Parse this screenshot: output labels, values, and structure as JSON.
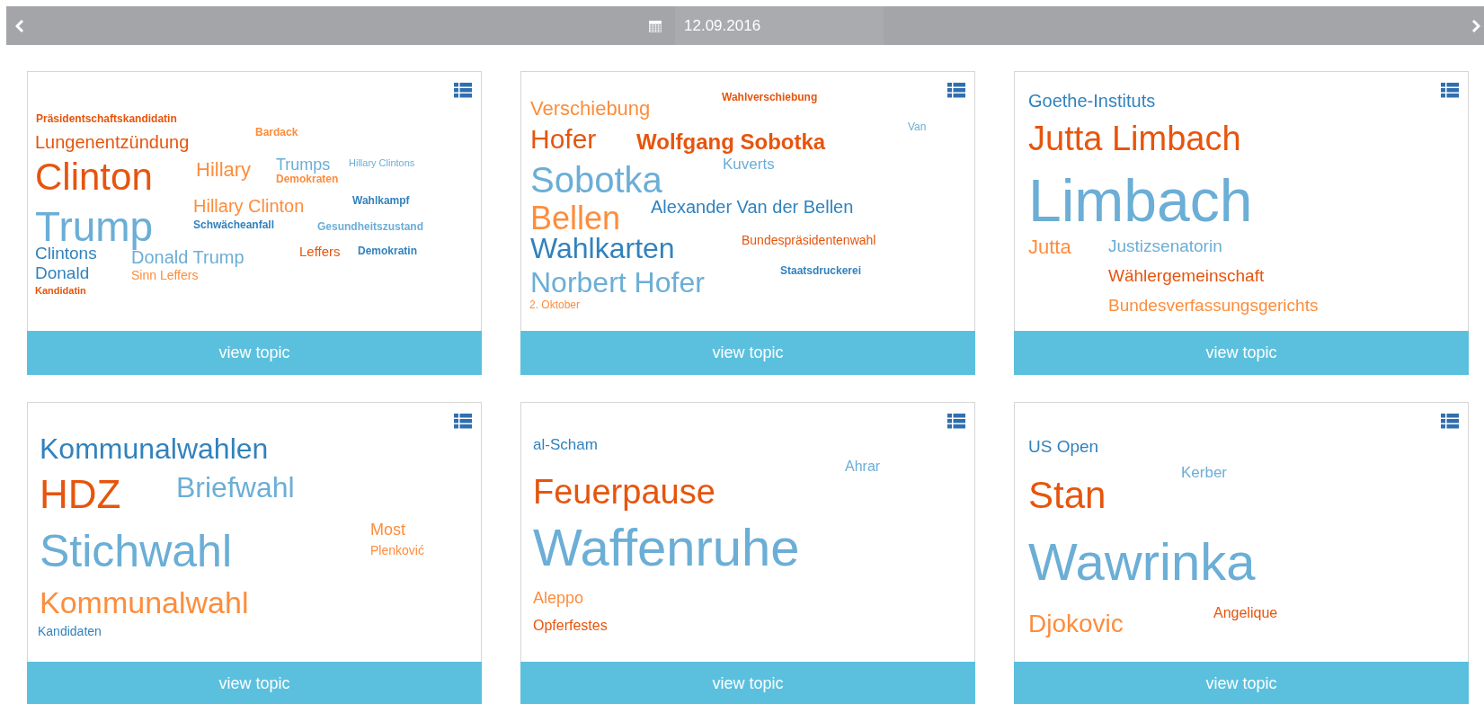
{
  "header": {
    "date": "12.09.2016"
  },
  "cards": [
    {
      "words": [
        {
          "text": "Präsidentschaftskandidatin",
          "color": "#e6550d"
        },
        {
          "text": "Bardack",
          "color": "#fd8d3c"
        },
        {
          "text": "Lungenentzündung",
          "color": "#e6550d"
        },
        {
          "text": "Clinton",
          "color": "#e6550d"
        },
        {
          "text": "Hillary",
          "color": "#fd8d3c"
        },
        {
          "text": "Trumps",
          "color": "#6baed6"
        },
        {
          "text": "Hillary Clintons",
          "color": "#6baed6"
        },
        {
          "text": "Demokraten",
          "color": "#fd8d3c"
        },
        {
          "text": "Hillary Clinton",
          "color": "#fd8d3c"
        },
        {
          "text": "Wahlkampf",
          "color": "#3182bd"
        },
        {
          "text": "Trump",
          "color": "#6baed6"
        },
        {
          "text": "Schwächeanfall",
          "color": "#3182bd"
        },
        {
          "text": "Gesundheitszustand",
          "color": "#6baed6"
        },
        {
          "text": "Clintons",
          "color": "#3182bd"
        },
        {
          "text": "Donald Trump",
          "color": "#6baed6"
        },
        {
          "text": "Leffers",
          "color": "#e6550d"
        },
        {
          "text": "Demokratin",
          "color": "#3182bd"
        },
        {
          "text": "Donald",
          "color": "#3182bd"
        },
        {
          "text": "Sinn Leffers",
          "color": "#fd8d3c"
        },
        {
          "text": "Kandidatin",
          "color": "#e6550d"
        }
      ],
      "button": "view topic"
    },
    {
      "words": [
        {
          "text": "Wahlverschiebung",
          "color": "#e6550d"
        },
        {
          "text": "Verschiebung",
          "color": "#fd8d3c"
        },
        {
          "text": "Van",
          "color": "#6baed6"
        },
        {
          "text": "Hofer",
          "color": "#e6550d"
        },
        {
          "text": "Wolfgang Sobotka",
          "color": "#e6550d"
        },
        {
          "text": "Kuverts",
          "color": "#6baed6"
        },
        {
          "text": "Sobotka",
          "color": "#6baed6"
        },
        {
          "text": "Bellen",
          "color": "#fd8d3c"
        },
        {
          "text": "Alexander Van der Bellen",
          "color": "#3182bd"
        },
        {
          "text": "Wahlkarten",
          "color": "#3182bd"
        },
        {
          "text": "Bundespräsidentenwahl",
          "color": "#e6550d"
        },
        {
          "text": "Staatsdruckerei",
          "color": "#3182bd"
        },
        {
          "text": "Norbert Hofer",
          "color": "#6baed6"
        },
        {
          "text": "2. Oktober",
          "color": "#fd8d3c"
        }
      ],
      "button": "view topic"
    },
    {
      "words": [
        {
          "text": "Goethe-Instituts",
          "color": "#3182bd"
        },
        {
          "text": "Jutta Limbach",
          "color": "#e6550d"
        },
        {
          "text": "Limbach",
          "color": "#6baed6"
        },
        {
          "text": "Jutta",
          "color": "#fd8d3c"
        },
        {
          "text": "Justizsenatorin",
          "color": "#6baed6"
        },
        {
          "text": "Wählergemeinschaft",
          "color": "#e6550d"
        },
        {
          "text": "Bundesverfassungsgerichts",
          "color": "#fd8d3c"
        }
      ],
      "button": "view topic"
    },
    {
      "words": [
        {
          "text": "Kommunalwahlen",
          "color": "#3182bd"
        },
        {
          "text": "HDZ",
          "color": "#e6550d"
        },
        {
          "text": "Briefwahl",
          "color": "#6baed6"
        },
        {
          "text": "Most",
          "color": "#fd8d3c"
        },
        {
          "text": "Plenković",
          "color": "#fd8d3c"
        },
        {
          "text": "Stichwahl",
          "color": "#6baed6"
        },
        {
          "text": "Kommunalwahl",
          "color": "#fd8d3c"
        },
        {
          "text": "Kandidaten",
          "color": "#3182bd"
        }
      ],
      "button": "view topic"
    },
    {
      "words": [
        {
          "text": "al-Scham",
          "color": "#3182bd"
        },
        {
          "text": "Ahrar",
          "color": "#6baed6"
        },
        {
          "text": "Feuerpause",
          "color": "#e6550d"
        },
        {
          "text": "Waffenruhe",
          "color": "#6baed6"
        },
        {
          "text": "Aleppo",
          "color": "#fd8d3c"
        },
        {
          "text": "Opferfestes",
          "color": "#e6550d"
        }
      ],
      "button": "view topic"
    },
    {
      "words": [
        {
          "text": "US Open",
          "color": "#3182bd"
        },
        {
          "text": "Kerber",
          "color": "#6baed6"
        },
        {
          "text": "Stan",
          "color": "#e6550d"
        },
        {
          "text": "Wawrinka",
          "color": "#6baed6"
        },
        {
          "text": "Angelique",
          "color": "#e6550d"
        },
        {
          "text": "Djokovic",
          "color": "#fd8d3c"
        }
      ],
      "button": "view topic"
    }
  ]
}
